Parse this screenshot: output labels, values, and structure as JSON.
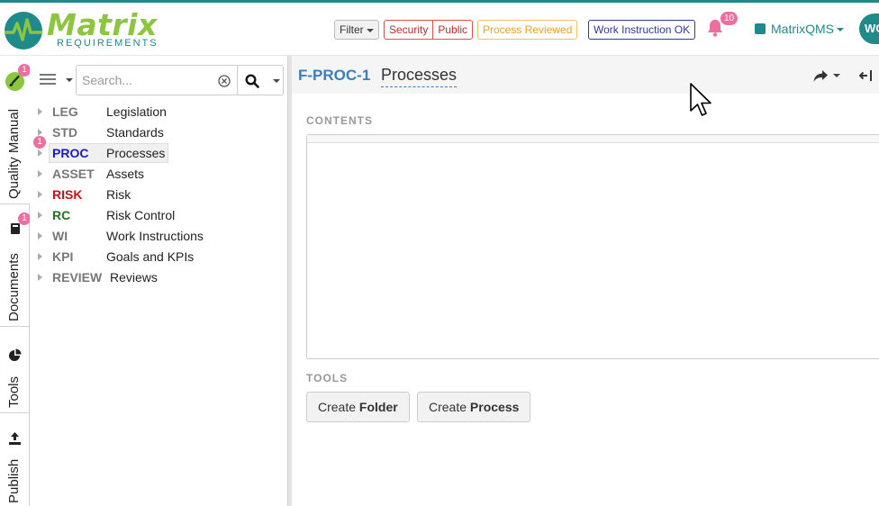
{
  "header": {
    "logo_word": "Matrix",
    "logo_sub": "REQUIREMENTS",
    "filter_label": "Filter",
    "security_label": "Security",
    "public_label": "Public",
    "process_reviewed_label": "Process Reviewed",
    "work_instruction_ok_label": "Work Instruction OK",
    "notification_count": "10",
    "project_name": "MatrixQMS",
    "avatar_initials": "WC",
    "colors": {
      "brand_teal": "#1f8a8a",
      "brand_green": "#8cc63f",
      "badge_pink": "#ec6fa2"
    }
  },
  "rail": {
    "tabs": [
      {
        "label": "Quality Manual",
        "icon": "brush-icon",
        "badge": "1"
      },
      {
        "label": "Documents",
        "icon": "book-icon",
        "badge": "1"
      },
      {
        "label": "Tools",
        "icon": "pie-chart-icon"
      },
      {
        "label": "Publish",
        "icon": "upload-icon"
      }
    ]
  },
  "tree": {
    "search_placeholder": "Search...",
    "items": [
      {
        "code": "LEG",
        "name": "Legislation",
        "color": "#777777"
      },
      {
        "code": "STD",
        "name": "Standards",
        "color": "#777777"
      },
      {
        "code": "PROC",
        "name": "Processes",
        "color": "#1a1acc",
        "badge": "1",
        "selected": true
      },
      {
        "code": "ASSET",
        "name": "Assets",
        "color": "#777777"
      },
      {
        "code": "RISK",
        "name": "Risk",
        "color": "#d01010"
      },
      {
        "code": "RC",
        "name": "Risk Control",
        "color": "#1a7a1a"
      },
      {
        "code": "WI",
        "name": "Work Instructions",
        "color": "#777777"
      },
      {
        "code": "KPI",
        "name": "Goals and KPIs",
        "color": "#777777"
      },
      {
        "code": "REVIEW",
        "name": "Reviews",
        "color": "#777777"
      }
    ]
  },
  "main": {
    "item_id": "F-PROC-1",
    "item_title": "Processes",
    "contents_label": "CONTENTS",
    "tools_label": "TOOLS",
    "create_folder": {
      "prefix": "Create",
      "strong": "Folder"
    },
    "create_process": {
      "prefix": "Create",
      "strong": "Process"
    }
  }
}
